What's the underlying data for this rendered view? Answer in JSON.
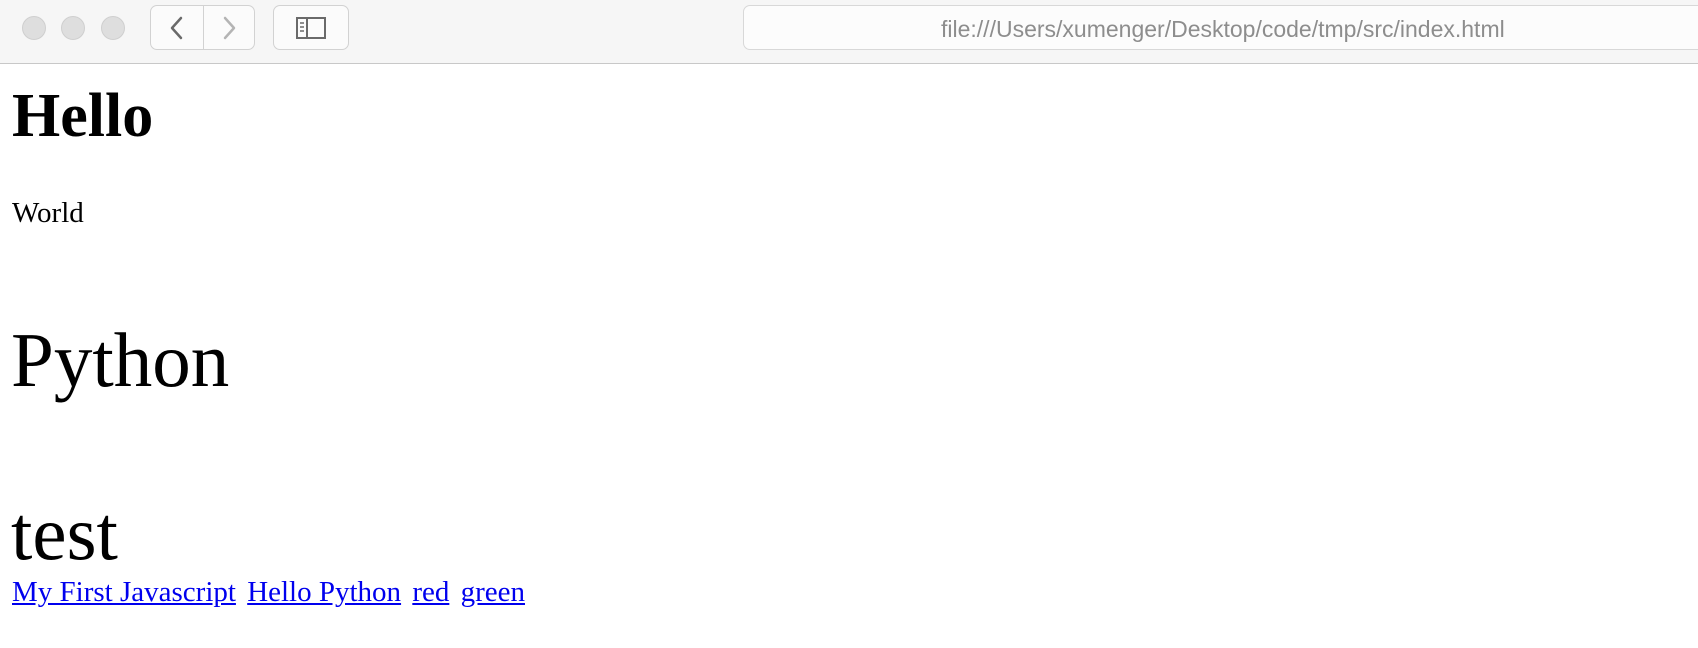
{
  "browser": {
    "url": "file:///Users/xumenger/Desktop/code/tmp/src/index.html",
    "icons": {
      "back": "chevron-left-icon",
      "forward": "chevron-right-icon",
      "sidebar": "sidebar-icon"
    }
  },
  "page": {
    "heading": "Hello",
    "paragraph": "World",
    "big_text_1": "Python",
    "big_text_2": "test",
    "links": [
      {
        "label": "My First Javascript"
      },
      {
        "label": "Hello Python"
      },
      {
        "label": "red"
      },
      {
        "label": "green"
      }
    ],
    "link_color": "#0000ee"
  }
}
